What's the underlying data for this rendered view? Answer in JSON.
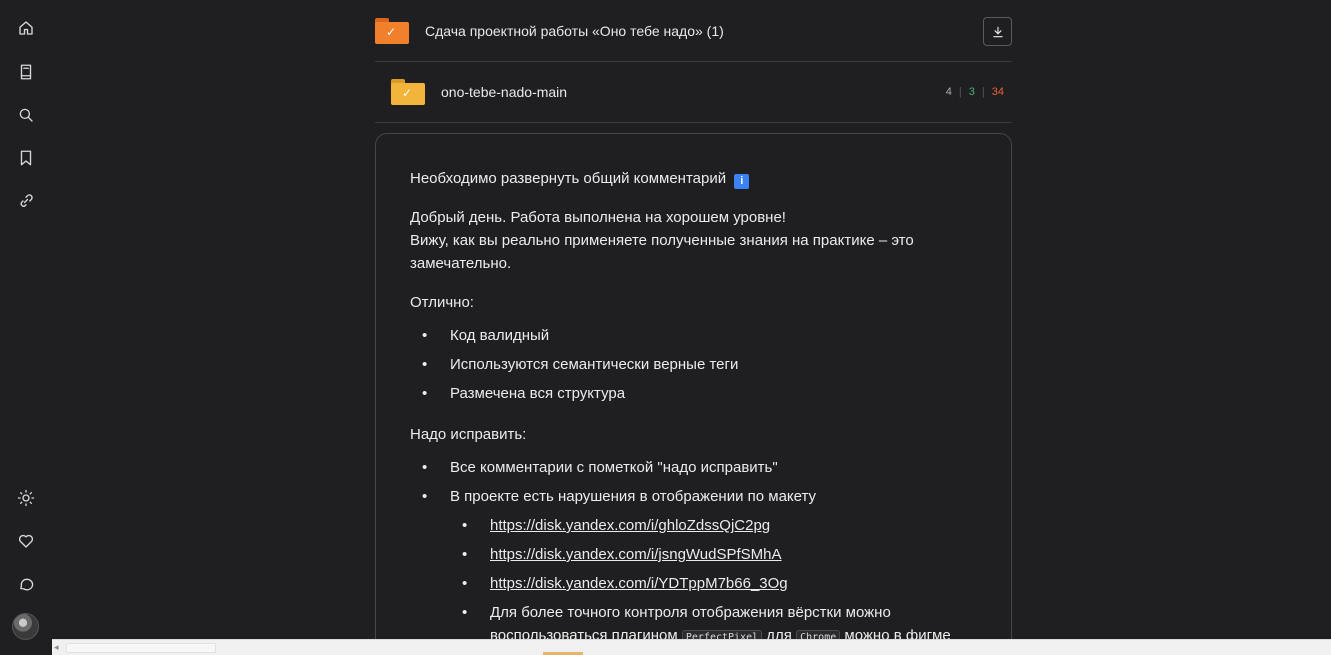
{
  "sidebar": {
    "icons": [
      "home-icon",
      "book-icon",
      "search-icon",
      "bookmark-icon",
      "link-icon",
      "sun-icon",
      "heart-icon",
      "chat-icon"
    ]
  },
  "file": {
    "title": "Сдача проектной работы «Оно тебе надо» (1)",
    "folder_color": "#f0802c"
  },
  "subfolder": {
    "name": "ono-tebe-nado-main",
    "folder_color": "#f2b43a",
    "stats": {
      "neutral": "4",
      "green": "3",
      "red": "34"
    }
  },
  "comment": {
    "expand_note": "Необходимо развернуть общий комментарий",
    "info_badge": "i",
    "greeting_line1": "Добрый день. Работа выполнена на хорошем уровне!",
    "greeting_line2": "Вижу, как вы реально применяете полученные знания на практике – это замечательно.",
    "good_heading": "Отлично:",
    "good_items": [
      "Код валидный",
      "Используются семантически верные теги",
      "Размечена вся структура"
    ],
    "fix_heading": "Надо исправить:",
    "fix_items": [
      "Все комментарии с пометкой \"надо исправить\"",
      "В проекте есть нарушения в отображении по макету"
    ],
    "links": [
      "https://disk.yandex.com/i/ghloZdssQjC2pg",
      "https://disk.yandex.com/i/jsngWudSPfSMhA",
      "https://disk.yandex.com/i/YDTppM7b66_3Og"
    ],
    "tip_line1": "Для более точного контроля отображения вёрстки можно",
    "tip_prefix": "воспользоваться плагином",
    "tip_code1": "PerfectPixel",
    "tip_mid": "для",
    "tip_code2": "Chrome",
    "tip_suffix": "можно в фигме"
  },
  "colors": {
    "stat_neutral": "#b0b0b0",
    "stat_green": "#4caf7d",
    "stat_red": "#e8623a"
  }
}
